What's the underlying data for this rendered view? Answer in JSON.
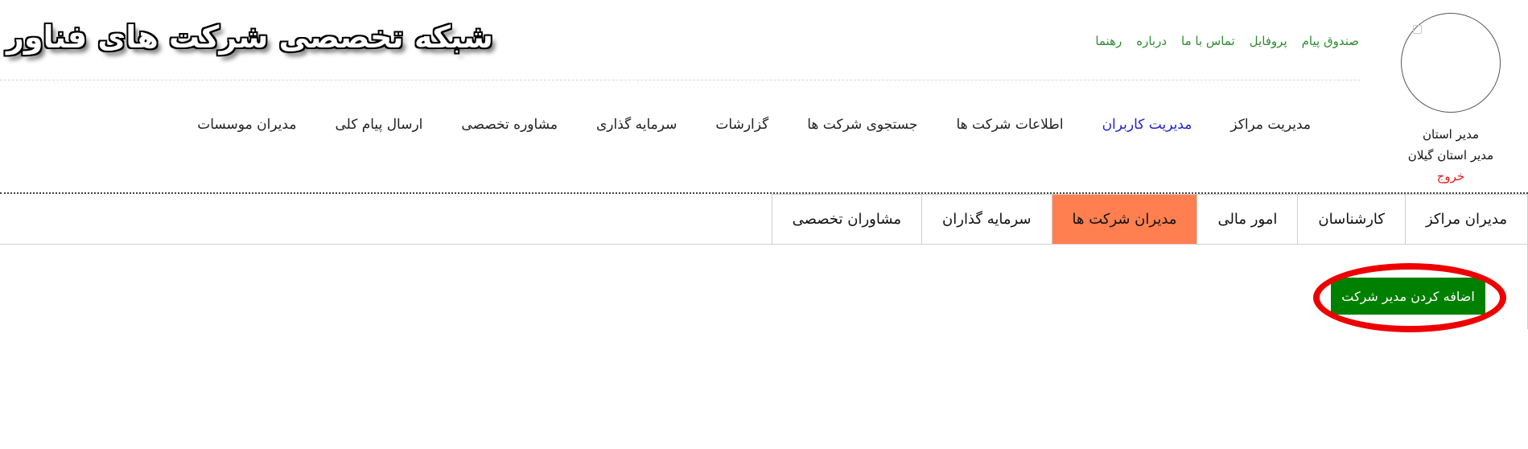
{
  "header": {
    "site_title": "شبکه تخصصی شرکت های فناور",
    "top_links": [
      "صندوق پیام",
      "پروفایل",
      "تماس با ما",
      "درباره",
      "رهنما"
    ]
  },
  "user": {
    "role": "مدیر استان",
    "name": "مدیر استان گیلان",
    "logout_label": "خروج"
  },
  "main_nav": {
    "items": [
      "مدیریت مراکز",
      "مدیریت کاربران",
      "اطلاعات شرکت ها",
      "جستجوی شرکت ها",
      "گزارشات",
      "سرمایه گذاری",
      "مشاوره تخصصی",
      "ارسال پیام کلی",
      "مدیران موسسات"
    ],
    "active_item": "مدیریت کاربران"
  },
  "tabs": {
    "items": [
      "مدیران مراکز",
      "کارشناسان",
      "امور مالی",
      "مدیران شرکت ها",
      "سرمایه گذاران",
      "مشاوران تخصصی"
    ],
    "active_item": "مدیران شرکت ها"
  },
  "actions": {
    "add_company_manager_label": "اضافه کردن مدیر شرکت"
  },
  "colors": {
    "link_green": "#2e8b2e",
    "active_nav_blue": "#1f1fd6",
    "active_tab": "#ff7f50",
    "button_green": "#008000",
    "logout_red": "#e21b1b",
    "highlight_red": "#ee0000"
  }
}
